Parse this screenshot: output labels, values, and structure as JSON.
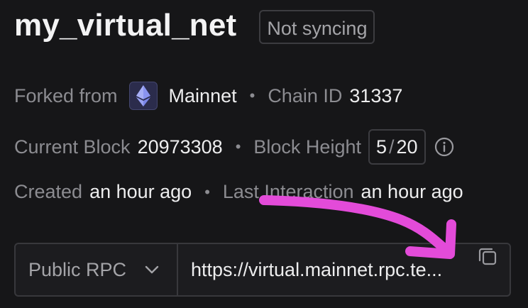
{
  "header": {
    "title": "my_virtual_net",
    "status": "Not syncing"
  },
  "meta": {
    "forked_from_label": "Forked from",
    "forked_from_value": "Mainnet",
    "chain_id_label": "Chain ID",
    "chain_id_value": "31337",
    "current_block_label": "Current Block",
    "current_block_value": "20973308",
    "block_height_label": "Block Height",
    "block_height_current": "5",
    "block_height_separator": "/",
    "block_height_max": "20",
    "created_label": "Created",
    "created_value": "an hour ago",
    "last_interaction_label": "Last Interaction",
    "last_interaction_value": "an hour ago",
    "separator": "•"
  },
  "rpc": {
    "selected": "Public RPC",
    "url": "https://virtual.mainnet.rpc.te..."
  },
  "icons": {
    "network": "ethereum-icon",
    "info": "info-icon",
    "dropdown": "chevron-down-icon",
    "copy": "copy-icon"
  },
  "colors": {
    "background": "#161618",
    "accent_annotation": "#e34bd9",
    "ethereum": "#7b86e8"
  }
}
